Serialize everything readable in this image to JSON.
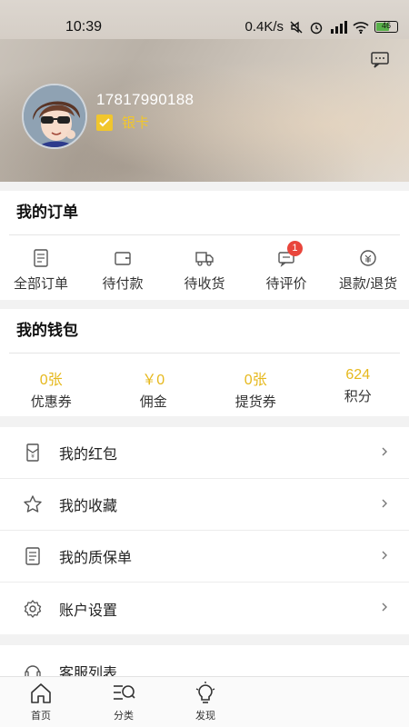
{
  "status_bar": {
    "time": "10:39",
    "net_speed": "0.4K/s",
    "battery": "46"
  },
  "profile": {
    "phone": "17817990188",
    "tier": "银卡",
    "tier_color": "#f1c62c"
  },
  "orders": {
    "title": "我的订单",
    "items": [
      {
        "label": "全部订单",
        "icon": "document-list-icon"
      },
      {
        "label": "待付款",
        "icon": "wallet-icon"
      },
      {
        "label": "待收货",
        "icon": "truck-icon"
      },
      {
        "label": "待评价",
        "icon": "comment-icon",
        "badge": "1"
      },
      {
        "label": "退款/退货",
        "icon": "refund-icon"
      }
    ]
  },
  "wallet": {
    "title": "我的钱包",
    "accent": "#e6b81c",
    "items": [
      {
        "value": "0张",
        "label": "优惠券"
      },
      {
        "value": "￥0",
        "label": "佣金"
      },
      {
        "value": "0张",
        "label": "提货券"
      },
      {
        "value": "624",
        "label": "积分"
      }
    ]
  },
  "menu": {
    "items": [
      {
        "label": "我的红包",
        "icon": "red-envelope-icon"
      },
      {
        "label": "我的收藏",
        "icon": "star-icon"
      },
      {
        "label": "我的质保单",
        "icon": "warranty-icon"
      },
      {
        "label": "账户设置",
        "icon": "gear-icon"
      }
    ],
    "service": {
      "label": "客服列表",
      "icon": "headset-icon"
    }
  },
  "bottom_nav": {
    "items": [
      {
        "label": "首页",
        "icon": "home-icon"
      },
      {
        "label": "分类",
        "icon": "category-search-icon"
      },
      {
        "label": "发现",
        "icon": "lightbulb-icon"
      }
    ]
  }
}
